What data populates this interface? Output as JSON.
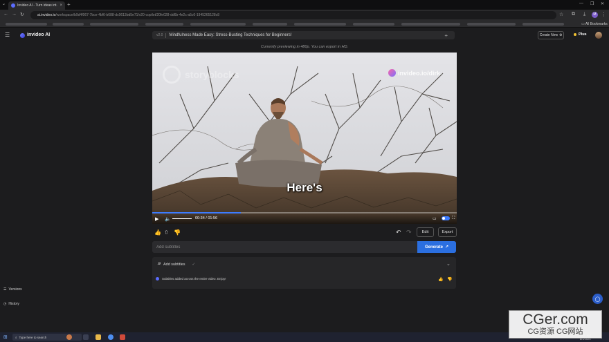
{
  "browser": {
    "tab_title": "Invideo AI - Turn ideas int...",
    "tab_close": "×",
    "new_tab": "+",
    "url_host": "ai.invideo.io",
    "url_path": "/workspace/b9d4f067-7bce-4bf6-b688-dc0613bd5e71/v20-copilot/20fe028-dd6b-4e2c-a5c6-1945265128c8",
    "all_bookmarks": "All Bookmarks",
    "profile_initial": "M",
    "icons": [
      "back-arrow",
      "forward-arrow",
      "reload",
      "star",
      "extensions",
      "download"
    ]
  },
  "app": {
    "logo": "invideo AI",
    "version": "v2.0",
    "project_title": "Mindfulness Made Easy: Stress-Busting Techniques for Beginners!",
    "title_plus": "+",
    "create_new": "Create New",
    "plan_badge": "Plus",
    "preview_note": "Currently previewing in 480p. You can export in HD.",
    "accent_color": "#2b6fe0"
  },
  "video": {
    "watermark_left": "storyblocks",
    "watermark_right": "invideo.io/dirk",
    "caption": "Here's",
    "current_time": "00:34",
    "total_time": "01:56",
    "time_display": "00:34 / 01:56",
    "progress": 0.29
  },
  "actions": {
    "edit": "Edit",
    "export": "Export"
  },
  "subtitles": {
    "placeholder": "Add subtitles",
    "generate": "Generate",
    "panel_title": "Add subtitles",
    "panel_check": "✓",
    "message": "Subtitles added across the entire video. Enjoy!"
  },
  "sidebar": {
    "versions": "Versions",
    "history": "History"
  },
  "taskbar": {
    "search_placeholder": "Type here to search",
    "time": "8:05 PM",
    "date": "8/1/2024"
  },
  "overlay": {
    "brand": "CGer.com",
    "sub": "CG资源 CG网站"
  }
}
